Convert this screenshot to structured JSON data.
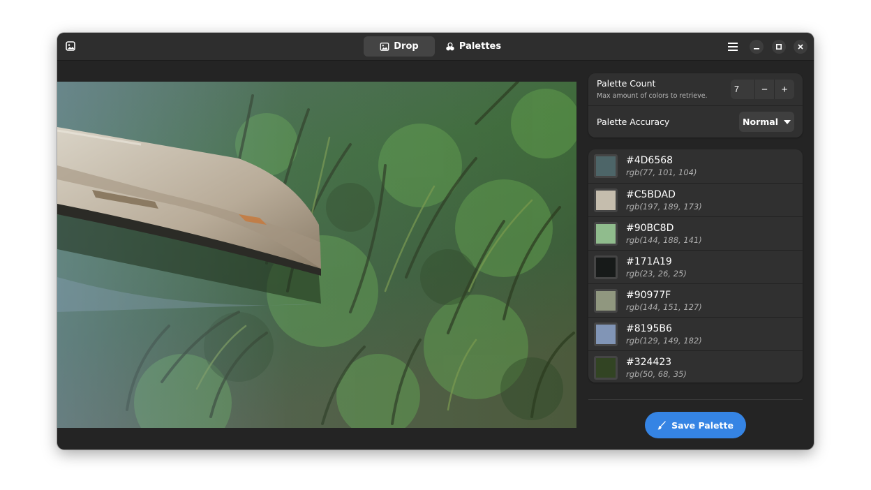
{
  "header": {
    "tabs": [
      {
        "label": "Drop",
        "icon": "image-icon",
        "active": true
      },
      {
        "label": "Palettes",
        "icon": "palette-icon",
        "active": false
      }
    ],
    "menu_icon": "hamburger-menu-icon",
    "window_controls": [
      "minimize",
      "maximize",
      "close"
    ]
  },
  "settings": {
    "palette_count": {
      "title": "Palette Count",
      "subtitle": "Max amount of colors to retrieve.",
      "value": "7",
      "decrement": "−",
      "increment": "+"
    },
    "palette_accuracy": {
      "title": "Palette Accuracy",
      "value": "Normal"
    }
  },
  "colors": [
    {
      "hex": "#4D6568",
      "rgb": "rgb(77, 101, 104)"
    },
    {
      "hex": "#C5BDAD",
      "rgb": "rgb(197, 189, 173)"
    },
    {
      "hex": "#90BC8D",
      "rgb": "rgb(144, 188, 141)"
    },
    {
      "hex": "#171A19",
      "rgb": "rgb(23, 26, 25)"
    },
    {
      "hex": "#90977F",
      "rgb": "rgb(144, 151, 127)"
    },
    {
      "hex": "#8195B6",
      "rgb": "rgb(129, 149, 182)"
    },
    {
      "hex": "#324423",
      "rgb": "rgb(50, 68, 35)"
    }
  ],
  "save_button": {
    "label": "Save Palette",
    "icon": "brush-icon"
  },
  "theme": {
    "accent": "#3584e4",
    "window_bg": "#242424",
    "panel_bg": "#303030"
  }
}
